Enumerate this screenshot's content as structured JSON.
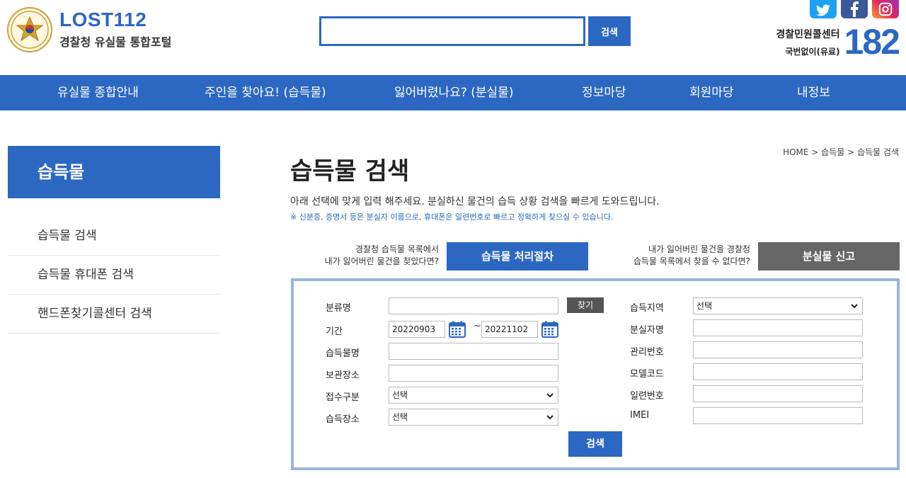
{
  "header": {
    "logo_title": "LOST112",
    "logo_subtitle": "경찰청 유실물 통합포털",
    "search_button": "검색",
    "search_value": "",
    "call_center_title": "경찰민원콜센터",
    "call_center_sub": "국번없이(유료)",
    "call_center_number": "182"
  },
  "nav": [
    "유실물 종합안내",
    "주인을 찾아요! (습득물)",
    "잃어버렸나요? (분실물)",
    "정보마당",
    "회원마당",
    "내정보"
  ],
  "sidebar": {
    "title": "습득물",
    "items": [
      "습득물 검색",
      "습득물 휴대폰 검색",
      "핸드폰찾기콜센터 검색"
    ]
  },
  "breadcrumb": "HOME > 습득물 > 습득물 검색",
  "main": {
    "title": "습득물 검색",
    "description": "아래 선택에 맞게 입력 해주세요. 분실하신 물건의 습득 상황 검색을 빠르게 도와드립니다.",
    "note": "※ 신분증, 증명서 등은 분실자 이름으로, 휴대폰은 일련번호로 빠르고 정확하게 찾으실 수 있습니다."
  },
  "promo": {
    "left_text_1": "경찰청 습득물 목록에서",
    "left_text_2": "내가 잃어버린 물건을 찾았다면?",
    "left_button": "습득물 처리절차",
    "right_text_1": "내가 잃어버린 물건을 경찰청",
    "right_text_2": "습득물 목록에서 찾을 수 없다면?",
    "right_button": "분실물 신고"
  },
  "form": {
    "category_label": "분류명",
    "category_value": "",
    "find_button": "찾기",
    "period_label": "기간",
    "date_from": "20220903",
    "date_to": "20221102",
    "tilde": "~",
    "item_name_label": "습득물명",
    "item_name_value": "",
    "storage_label": "보관장소",
    "storage_value": "",
    "receipt_label": "접수구분",
    "receipt_value": "선택",
    "place_label": "습득장소",
    "place_value": "선택",
    "region_label": "습득지역",
    "region_value": "선택",
    "owner_label": "분실자명",
    "owner_value": "",
    "manage_label": "관리번호",
    "manage_value": "",
    "model_label": "모델코드",
    "model_value": "",
    "serial_label": "일련번호",
    "serial_value": "",
    "imei_label": "IMEI",
    "imei_value": "",
    "submit_button": "검색"
  },
  "colors": {
    "primary": "#2c68c2",
    "dark_button": "#666666",
    "form_border": "#98b5dd"
  }
}
